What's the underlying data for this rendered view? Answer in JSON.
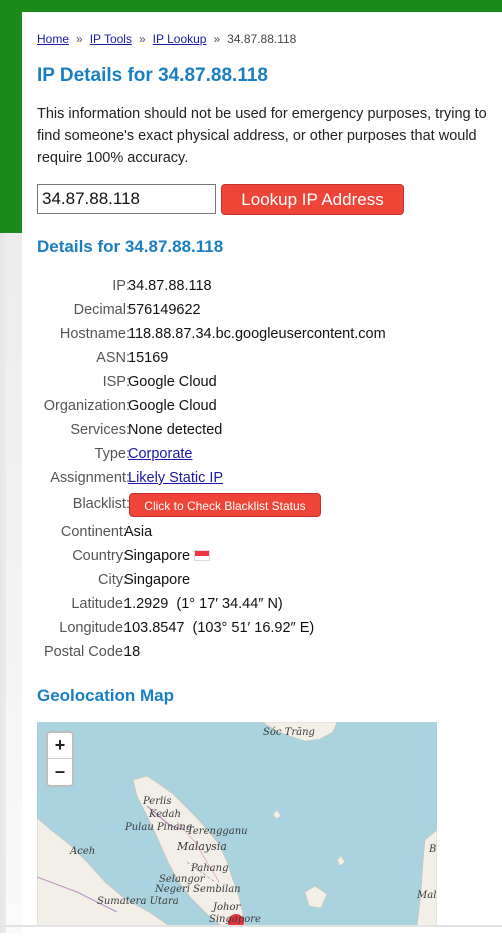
{
  "breadcrumb": {
    "items": [
      "Home",
      "IP Tools",
      "IP Lookup"
    ],
    "separator": "»",
    "current": "34.87.88.118"
  },
  "page_title": "IP Details for 34.87.88.118",
  "disclaimer": "This information should not be used for emergency purposes, trying to find someone's exact physical address, or other purposes that would require 100% accuracy.",
  "lookup": {
    "input_value": "34.87.88.118",
    "button_label": "Lookup IP Address"
  },
  "details_title": "Details for 34.87.88.118",
  "details": {
    "ip": {
      "label": "IP:",
      "value": "34.87.88.118"
    },
    "decimal": {
      "label": "Decimal:",
      "value": "576149622"
    },
    "hostname": {
      "label": "Hostname:",
      "value": "118.88.87.34.bc.googleusercontent.com"
    },
    "asn": {
      "label": "ASN:",
      "value": "15169"
    },
    "isp": {
      "label": "ISP:",
      "value": "Google Cloud"
    },
    "organization": {
      "label": "Organization:",
      "value": "Google Cloud"
    },
    "services": {
      "label": "Services:",
      "value": "None detected"
    },
    "type": {
      "label": "Type:",
      "value": "Corporate"
    },
    "assignment": {
      "label": "Assignment:",
      "value": "Likely Static IP"
    },
    "blacklist": {
      "label": "Blacklist:",
      "button_label": "Click to Check Blacklist Status"
    },
    "continent": {
      "label": "Continent:",
      "value": "Asia"
    },
    "country": {
      "label": "Country:",
      "value": "Singapore",
      "flag_colors": [
        "#ef3340",
        "#ffffff"
      ]
    },
    "city": {
      "label": "City:",
      "value": "Singapore"
    },
    "latitude": {
      "label": "Latitude:",
      "value": "1.2929  (1° 17′ 34.44″ N)"
    },
    "longitude": {
      "label": "Longitude:",
      "value": "103.8547  (103° 51′ 16.92″ E)"
    },
    "postal_code": {
      "label": "Postal Code:",
      "value": "18"
    }
  },
  "geo_title": "Geolocation Map",
  "map": {
    "zoom_in": "+",
    "zoom_out": "–",
    "labels": {
      "soc_trang": "Sóc Trăng",
      "perlis": "Perlis",
      "kedah": "Kedah",
      "pulau_pinang": "Pulau Pinang",
      "terengganu": "Terengganu",
      "malaysia": "Malaysia",
      "aceh": "Aceh",
      "pahang": "Pahang",
      "selangor": "Selangor",
      "negeri_sembilan": "Negeri Sembilan",
      "sumatera_utara": "Sumatera Utara",
      "johor": "Johor",
      "singapore": "Singapore",
      "b_edge": "B",
      "mal_edge": "Mal"
    },
    "colors": {
      "water": "#aad3df",
      "land": "#f2efe9",
      "border": "#b98fb9",
      "marker": "#e8343f"
    }
  },
  "colors": {
    "accent_green": "#1a8a1a",
    "heading_blue": "#1a7ec2",
    "button_red": "#ef4438",
    "link": "#1a1aa6"
  }
}
